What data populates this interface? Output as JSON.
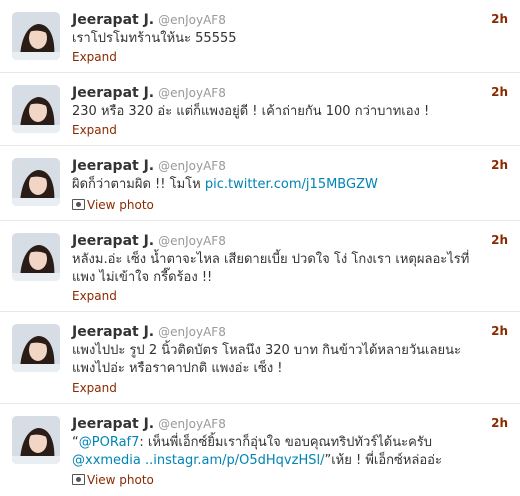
{
  "tweets": [
    {
      "fullname": "Jeerapat J.",
      "username": "@enJoyAF8",
      "time": "2h",
      "text": "เราโปรโมทร้านให้นะ 55555",
      "action": "Expand"
    },
    {
      "fullname": "Jeerapat J.",
      "username": "@enJoyAF8",
      "time": "2h",
      "text": "230 หรือ 320 อ่ะ แต่ก็แพงอยู่ดี ! เค้าถ่ายกัน 100 กว่าบาทเอง !",
      "action": "Expand"
    },
    {
      "fullname": "Jeerapat J.",
      "username": "@enJoyAF8",
      "time": "2h",
      "text_before": "ผิดก็ว่าตามผิด !! โมโห ",
      "link": "pic.twitter.com/j15MBGZW",
      "action": "View photo",
      "action_icon": "photo-icon"
    },
    {
      "fullname": "Jeerapat J.",
      "username": "@enJoyAF8",
      "time": "2h",
      "line1": "หลังม.อ่ะ เซ็ง น้ำตาจะไหล เสียดายเบี้ย ปวดใจ โง่ โกงเรา เหตุผลอะไรที่",
      "line2": "แพง ไม่เข้าใจ กรี๊ดร้อง !!",
      "action": "Expand"
    },
    {
      "fullname": "Jeerapat J.",
      "username": "@enJoyAF8",
      "time": "2h",
      "line1": "แพงไปปะ รูป 2 นิ้วติดบัตร โหลนึง 320 บาท กินข้าวได้หลายวันเลยนะ",
      "line2": "แพงไปอ่ะ หรือราคาปกติ แพงอ่ะ เซ็ง !",
      "action": "Expand"
    },
    {
      "fullname": "Jeerapat J.",
      "username": "@enJoyAF8",
      "time": "2h",
      "quote_open": "“",
      "mention": "@PORaf7",
      "line1_rest": ": เห็นพี่เอ็กซ์ยิ้มเราก็อุ่นใจ ขอบคุณทริปทัวร์ได้นะครับ",
      "mention2": "@xxmedia",
      "link": " ..instagr.am/p/O5dHqvzHSl/",
      "line2_rest": "”เห้ย ! พี่เอ็กซ์หล่ออ่ะ",
      "action": "View photo",
      "action_icon": "photo-icon"
    }
  ]
}
